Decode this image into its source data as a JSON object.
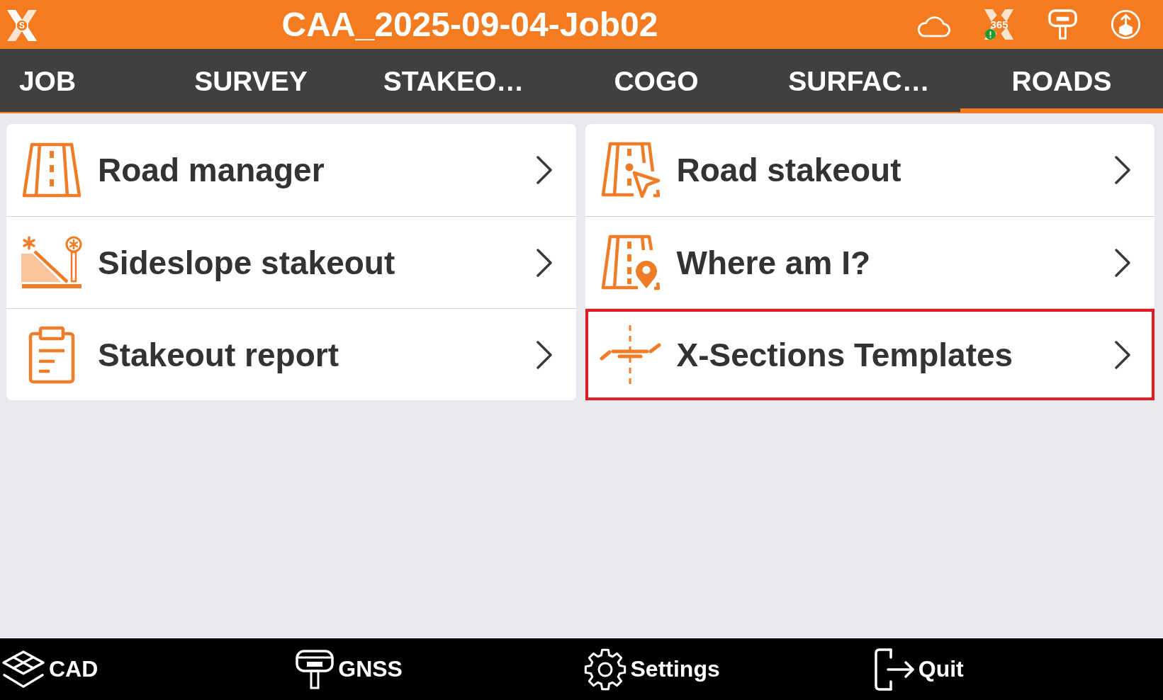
{
  "header": {
    "logo_letter": "S",
    "title": "CAA_2025-09-04-Job02",
    "license_label": "365"
  },
  "tabs": [
    {
      "label": "JOB",
      "selected": false
    },
    {
      "label": "SURVEY",
      "selected": false
    },
    {
      "label": "STAKEO…",
      "selected": false
    },
    {
      "label": "COGO",
      "selected": false
    },
    {
      "label": "SURFAC…",
      "selected": false
    },
    {
      "label": "ROADS",
      "selected": true
    }
  ],
  "menu_columns": [
    {
      "items": [
        {
          "label": "Road manager",
          "highlighted": false
        },
        {
          "label": "Sideslope stakeout",
          "highlighted": false
        },
        {
          "label": "Stakeout report",
          "highlighted": false
        }
      ]
    },
    {
      "items": [
        {
          "label": "Road stakeout",
          "highlighted": false
        },
        {
          "label": "Where am I?",
          "highlighted": false
        },
        {
          "label": "X-Sections Templates",
          "highlighted": true
        }
      ]
    }
  ],
  "bottom_bar": [
    {
      "label": "CAD"
    },
    {
      "label": "GNSS"
    },
    {
      "label": "Settings"
    },
    {
      "label": "Quit"
    }
  ]
}
